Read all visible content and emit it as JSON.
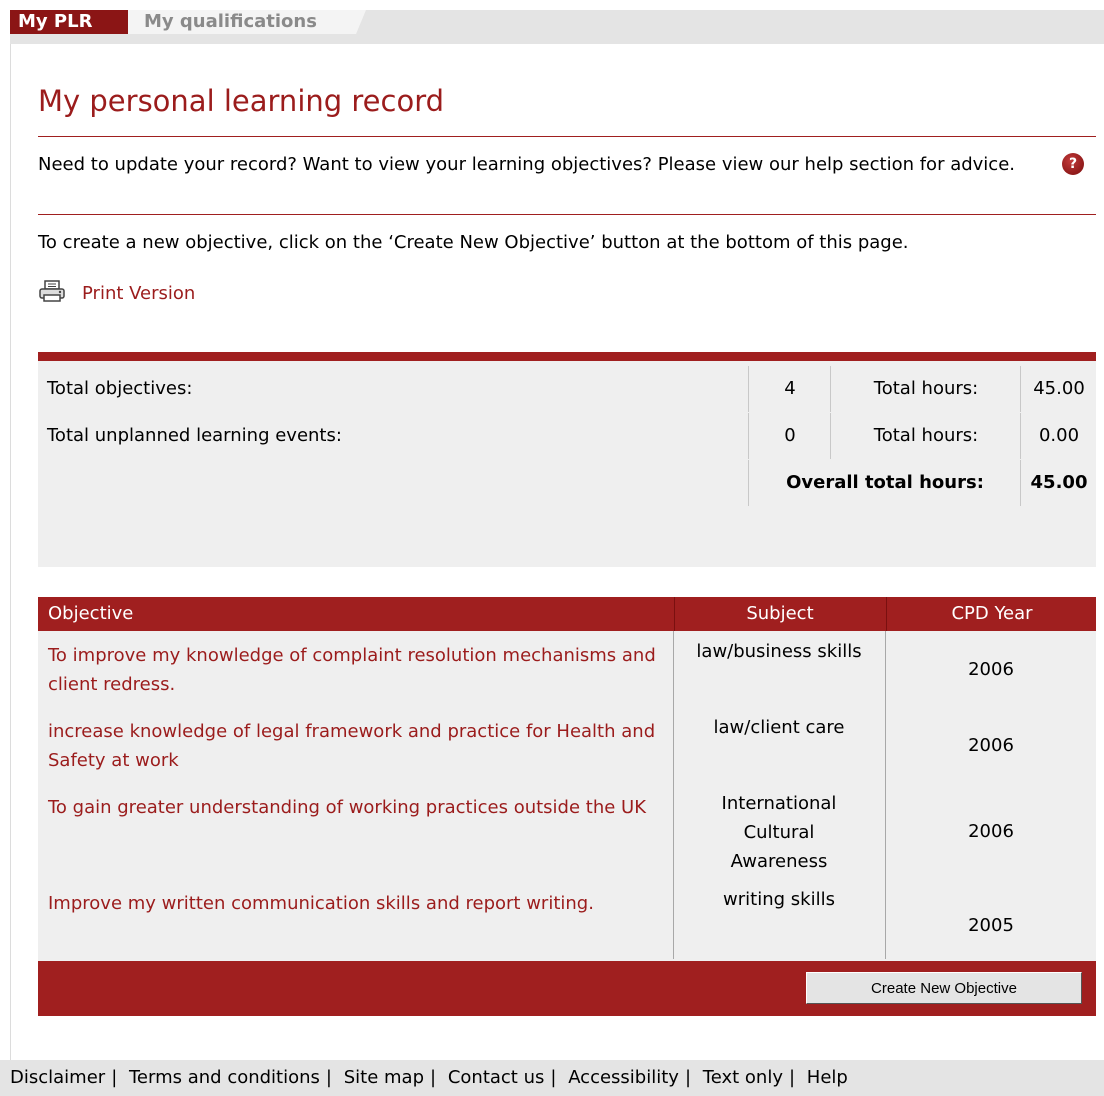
{
  "tabs": [
    {
      "label": "My PLR",
      "active": true
    },
    {
      "label": "My qualifications",
      "active": false
    }
  ],
  "page_title": "My personal learning record",
  "help_text": "Need to update your record? Want to view your learning objectives? Please view our help section for advice.",
  "help_icon": "question-mark-icon",
  "create_instructions": "To create a new objective, click on the ‘Create New Objective’ button at the bottom of this page.",
  "print_link": "Print Version",
  "totals": [
    {
      "label": "Total objectives:",
      "count": "4",
      "hours_label": "Total hours:",
      "hours": "45.00"
    },
    {
      "label": "Total unplanned learning events:",
      "count": "0",
      "hours_label": "Total hours:",
      "hours": "0.00"
    }
  ],
  "overall": {
    "label": "Overall total hours:",
    "hours": "45.00"
  },
  "table": {
    "columns": [
      "Objective",
      "Subject",
      "CPD Year"
    ],
    "rows": [
      {
        "objective": "To improve my knowledge of complaint resolution mechanisms and client redress.",
        "subject": "law/business skills",
        "year": "2006"
      },
      {
        "objective": "increase knowledge of legal framework and practice for Health and Safety at work",
        "subject": "law/client care",
        "year": "2006"
      },
      {
        "objective": "To gain greater understanding of working practices outside the UK",
        "subject": "International Cultural Awareness",
        "year": "2006"
      },
      {
        "objective": "Improve my written communication skills and report writing.",
        "subject": "writing skills",
        "year": "2005"
      }
    ]
  },
  "create_button": "Create New Objective",
  "footer_links": [
    "Disclaimer",
    "Terms and conditions",
    "Site map",
    "Contact us",
    "Accessibility",
    "Text only",
    "Help"
  ],
  "colors": {
    "brand": "#a01f1f",
    "link": "#9b1c1c",
    "panel": "#efefef"
  }
}
